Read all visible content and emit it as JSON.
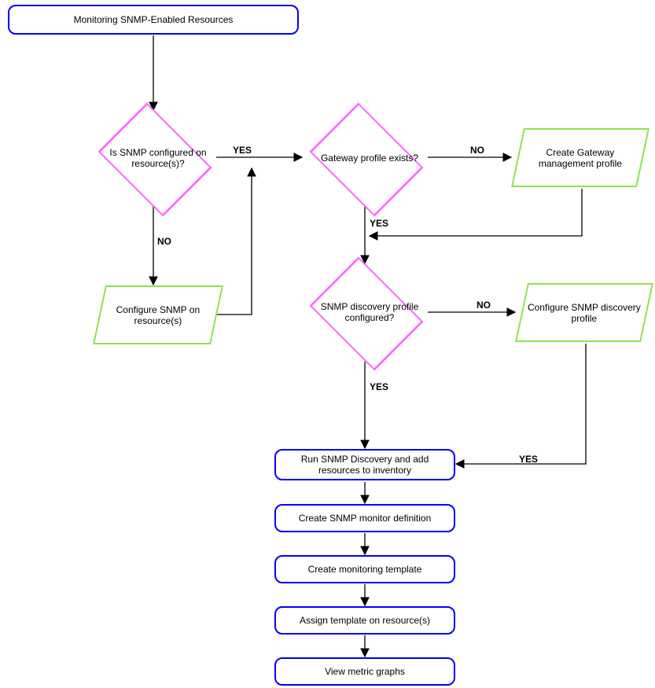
{
  "chart_data": {
    "type": "flowchart",
    "title": "Monitoring SNMP-Enabled Resources",
    "nodes": [
      {
        "id": "start",
        "type": "terminal",
        "label": "Monitoring SNMP-Enabled Resources"
      },
      {
        "id": "dec_conf",
        "type": "decision",
        "label": "Is SNMP configured on resource(s)?"
      },
      {
        "id": "conf_snmp",
        "type": "process",
        "label": "Configure SNMP on resource(s)"
      },
      {
        "id": "dec_gw",
        "type": "decision",
        "label": "Gateway profile exists?"
      },
      {
        "id": "create_gw",
        "type": "process",
        "label": "Create Gateway management profile"
      },
      {
        "id": "dec_disc",
        "type": "decision",
        "label": "SNMP discovery profile configured?"
      },
      {
        "id": "conf_disc",
        "type": "process",
        "label": "Configure SNMP discovery profile"
      },
      {
        "id": "run_disc",
        "type": "action",
        "label": "Run SNMP Discovery and add resources to inventory"
      },
      {
        "id": "create_mon",
        "type": "action",
        "label": "Create SNMP monitor definition"
      },
      {
        "id": "create_tmpl",
        "type": "action",
        "label": "Create monitoring template"
      },
      {
        "id": "assign_tmpl",
        "type": "action",
        "label": "Assign template on resource(s)"
      },
      {
        "id": "view",
        "type": "action",
        "label": "View metric graphs"
      }
    ],
    "edges": [
      {
        "from": "start",
        "to": "dec_conf",
        "label": ""
      },
      {
        "from": "dec_conf",
        "to": "dec_gw",
        "label": "YES"
      },
      {
        "from": "dec_conf",
        "to": "conf_snmp",
        "label": "NO"
      },
      {
        "from": "conf_snmp",
        "to": "dec_gw",
        "label": ""
      },
      {
        "from": "dec_gw",
        "to": "create_gw",
        "label": "NO"
      },
      {
        "from": "dec_gw",
        "to": "dec_disc",
        "label": "YES"
      },
      {
        "from": "create_gw",
        "to": "dec_disc",
        "label": ""
      },
      {
        "from": "dec_disc",
        "to": "conf_disc",
        "label": "NO"
      },
      {
        "from": "dec_disc",
        "to": "run_disc",
        "label": "YES"
      },
      {
        "from": "conf_disc",
        "to": "run_disc",
        "label": "YES"
      },
      {
        "from": "run_disc",
        "to": "create_mon",
        "label": ""
      },
      {
        "from": "create_mon",
        "to": "create_tmpl",
        "label": ""
      },
      {
        "from": "create_tmpl",
        "to": "assign_tmpl",
        "label": ""
      },
      {
        "from": "assign_tmpl",
        "to": "view",
        "label": ""
      }
    ]
  },
  "labels": {
    "yes": "YES",
    "no": "NO"
  }
}
